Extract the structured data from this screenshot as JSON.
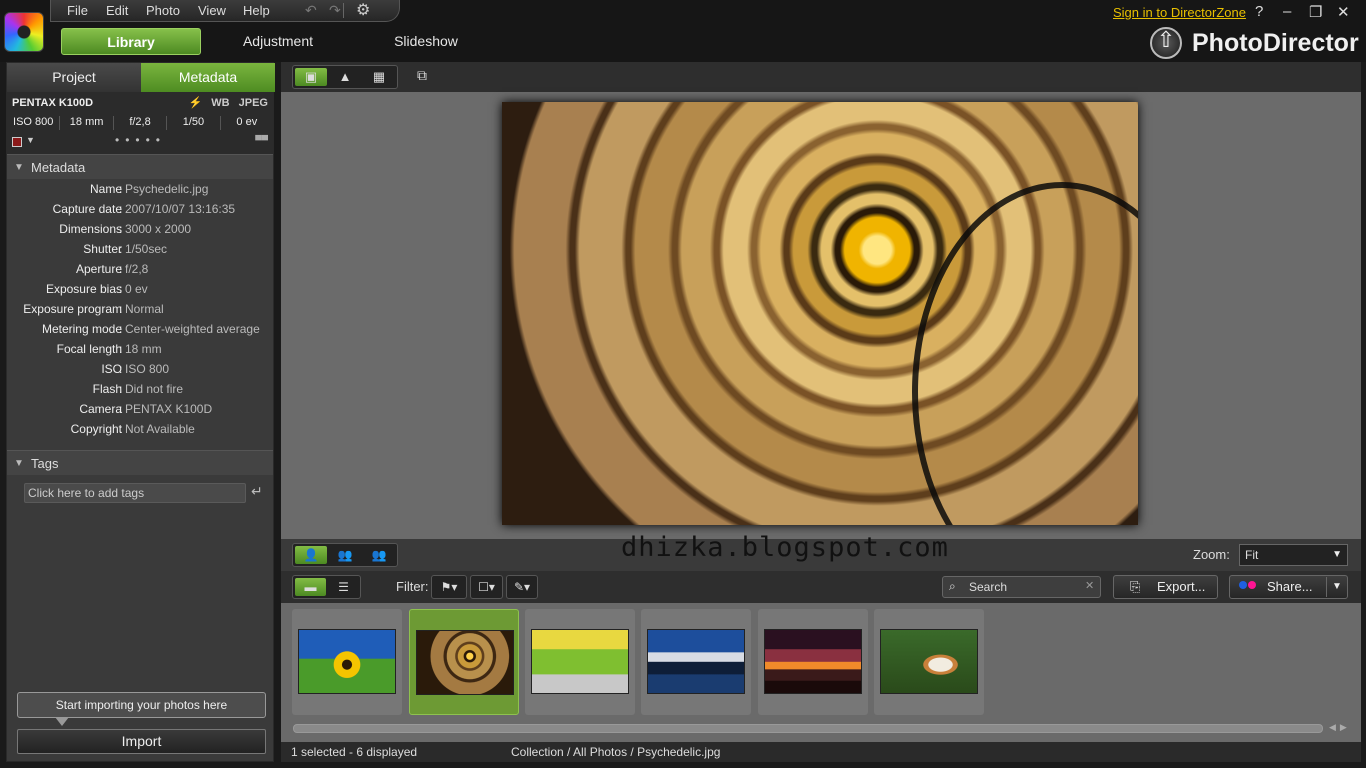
{
  "menu": {
    "items": [
      "File",
      "Edit",
      "Photo",
      "View",
      "Help"
    ]
  },
  "modes": {
    "library": "Library",
    "adjustment": "Adjustment",
    "slideshow": "Slideshow"
  },
  "account": {
    "sign_in": "Sign in to DirectorZone",
    "help": "?",
    "minimize": "–",
    "restore": "❐",
    "close": "✕"
  },
  "brand": {
    "name": "PhotoDirector"
  },
  "panel_tabs": {
    "project": "Project",
    "metadata": "Metadata"
  },
  "camera_strip": {
    "model": "PENTAX K100D",
    "badges": {
      "flash": "⚡",
      "wb": "WB",
      "format": "JPEG"
    },
    "exif": [
      "ISO 800",
      "18 mm",
      "f/2,8",
      "1/50",
      "0 ev"
    ]
  },
  "metadata": {
    "title": "Metadata",
    "rows": [
      {
        "key": "Name",
        "value": "Psychedelic.jpg"
      },
      {
        "key": "Capture date",
        "value": "2007/10/07 13:16:35"
      },
      {
        "key": "Dimensions",
        "value": "3000 x 2000"
      },
      {
        "key": "Shutter",
        "value": "1/50sec"
      },
      {
        "key": "Aperture",
        "value": "f/2,8"
      },
      {
        "key": "Exposure bias",
        "value": "0 ev"
      },
      {
        "key": "Exposure program",
        "value": "Normal"
      },
      {
        "key": "Metering mode",
        "value": "Center-weighted average"
      },
      {
        "key": "Focal length",
        "value": "18 mm"
      },
      {
        "key": "ISO",
        "value": "ISO 800"
      },
      {
        "key": "Flash",
        "value": "Did not fire"
      },
      {
        "key": "Camera",
        "value": "PENTAX K100D"
      },
      {
        "key": "Copyright",
        "value": "Not Available"
      }
    ]
  },
  "tags": {
    "title": "Tags",
    "placeholder": "Click here to add tags"
  },
  "import": {
    "hint": "Start importing your photos here",
    "button": "Import"
  },
  "watermark": "dhizka.blogspot.com",
  "zoom": {
    "label": "Zoom:",
    "value": "Fit"
  },
  "filter": {
    "label": "Filter:"
  },
  "search": {
    "placeholder": "Search"
  },
  "actions": {
    "export": "Export...",
    "share": "Share..."
  },
  "thumbnails": [
    {
      "name": "sunflower",
      "selected": false
    },
    {
      "name": "Psychedelic.jpg",
      "selected": true
    },
    {
      "name": "field-bicycle",
      "selected": false
    },
    {
      "name": "mountain-lake",
      "selected": false
    },
    {
      "name": "sunset",
      "selected": false
    },
    {
      "name": "cat",
      "selected": false
    }
  ],
  "status": {
    "count": "1 selected - 6 displayed",
    "path": "Collection / All Photos / Psychedelic.jpg"
  },
  "colors": {
    "accent_green": "#6d9a34",
    "signin_link": "#e8c000",
    "share_blue": "#1e5fe0",
    "share_pink": "#ff1493"
  }
}
